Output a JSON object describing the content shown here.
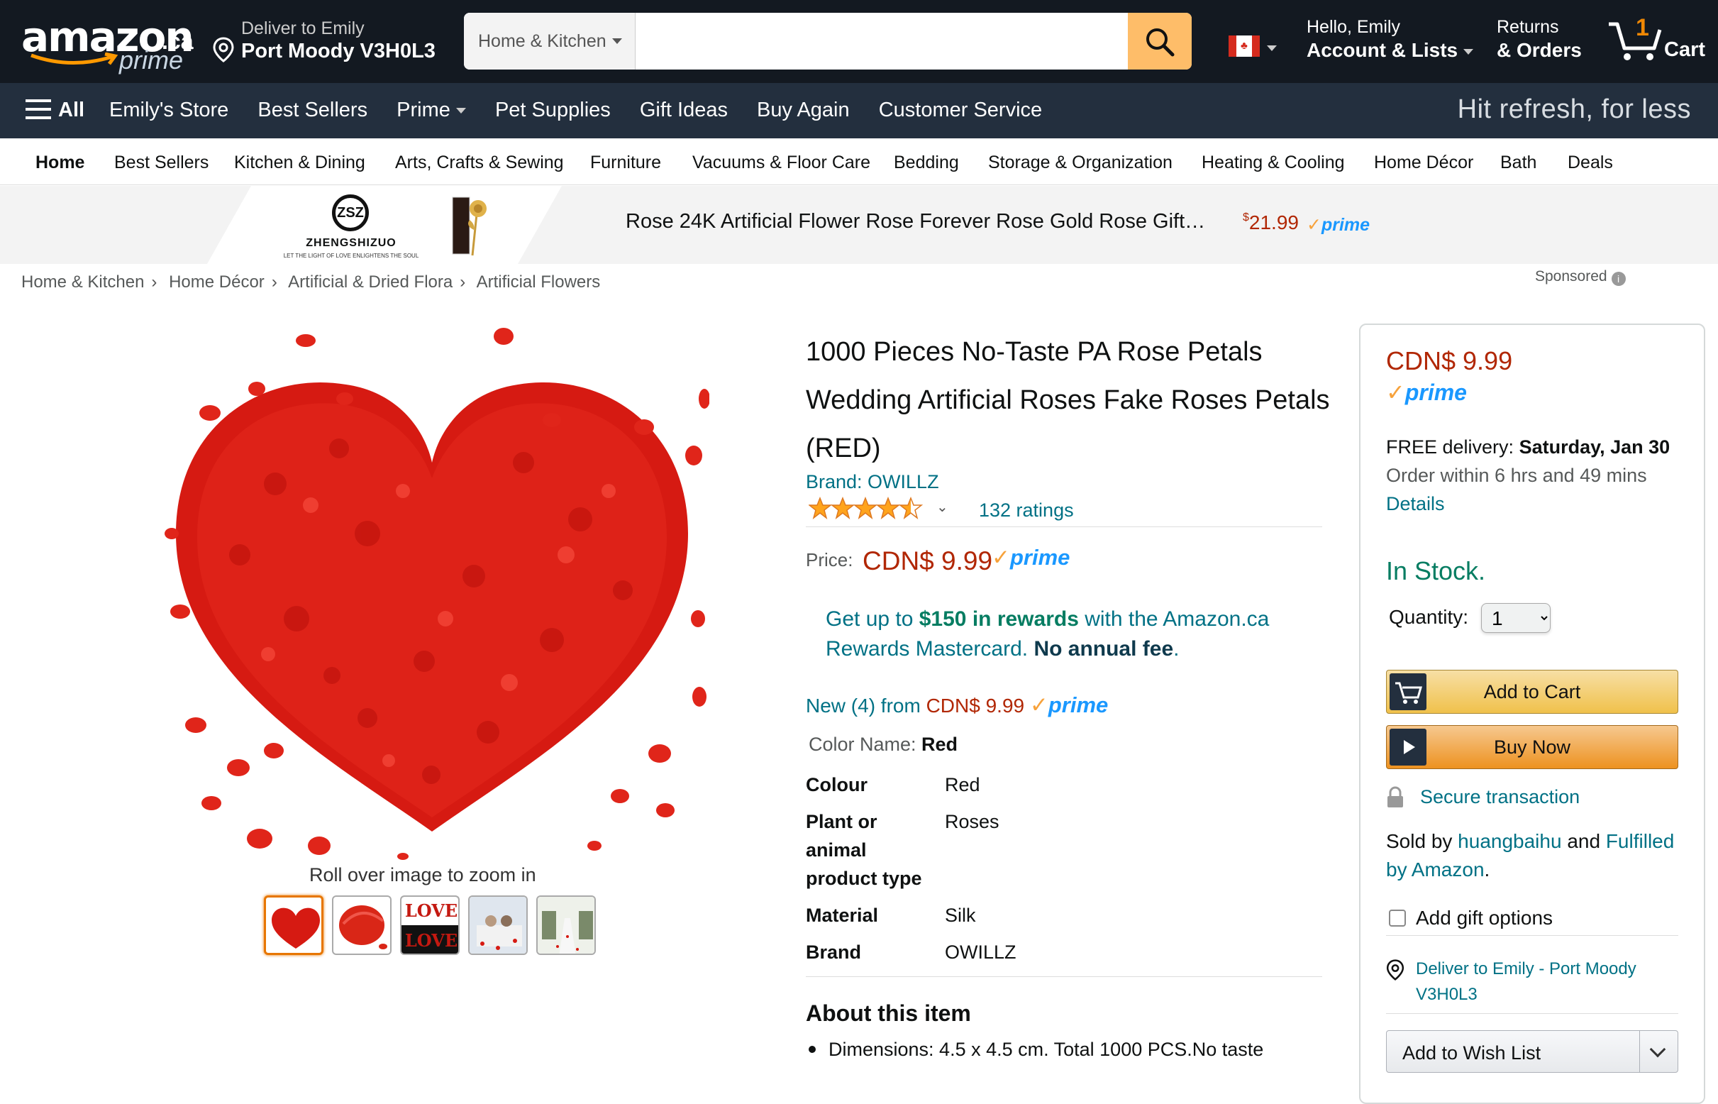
{
  "header": {
    "logo_word": "amazon",
    "logo_tld": ".ca",
    "logo_sub": "prime",
    "deliver_line1": "Deliver to Emily",
    "deliver_line2": "Port Moody V3H0L3",
    "search_category": "Home & Kitchen",
    "search_placeholder": "",
    "account_line1": "Hello, Emily",
    "account_line2": "Account & Lists",
    "returns_line1": "Returns",
    "returns_line2": "& Orders",
    "cart_count": "1",
    "cart_label": "Cart"
  },
  "main_nav": {
    "all_label": "All",
    "links": [
      "Emily's Store",
      "Best Sellers",
      "Prime",
      "Pet Supplies",
      "Gift Ideas",
      "Buy Again",
      "Customer Service"
    ],
    "promo": "Hit refresh, for less"
  },
  "sub_nav": [
    "Home",
    "Best Sellers",
    "Kitchen & Dining",
    "Arts, Crafts & Sewing",
    "Furniture",
    "Vacuums & Floor Care",
    "Bedding",
    "Storage & Organization",
    "Heating & Cooling",
    "Home Décor",
    "Bath",
    "Deals"
  ],
  "sponsored_banner": {
    "brand_mark": "ZSZ",
    "brand_name": "ZHENGSHIZUO",
    "brand_tagline": "LET THE LIGHT OF LOVE ENLIGHTENS THE SOUL",
    "title": "Rose 24K Artificial Flower Rose Forever Rose Gold Rose Gift…",
    "price_symbol": "$",
    "price": "21.99",
    "prime": "prime"
  },
  "breadcrumb": [
    "Home & Kitchen",
    "Home Décor",
    "Artificial & Dried Flora",
    "Artificial Flowers"
  ],
  "breadcrumb_sep": "›",
  "sponsored_label": "Sponsored",
  "gallery": {
    "zoom_hint": "Roll over image to zoom in",
    "thumb_love_top": "LOVE",
    "thumb_love_bottom": "LOVE"
  },
  "product": {
    "title": "1000 Pieces No-Taste PA Rose Petals Wedding Artificial Roses Fake Roses Petals (RED)",
    "brand_link": "Brand: OWILLZ",
    "rating": 4.5,
    "ratings_count": "132 ratings",
    "price_label": "Price:",
    "price": "CDN$ 9.99",
    "prime": "prime",
    "rewards_pre": "Get up to ",
    "rewards_amount": "$150 in rewards",
    "rewards_mid": " with the Amazon.ca Rewards Mastercard. ",
    "rewards_fee": "No annual fee",
    "rewards_end": ".",
    "new_from_prefix": "New (4) from ",
    "new_from_price": "CDN$ 9.99",
    "color_name_label": "Color Name: ",
    "color_name_value": "Red",
    "specs": [
      {
        "key": "Colour",
        "value": "Red"
      },
      {
        "key": "Plant or animal product type",
        "value": "Roses"
      },
      {
        "key": "Material",
        "value": "Silk"
      },
      {
        "key": "Brand",
        "value": "OWILLZ"
      }
    ],
    "about_heading": "About this item",
    "bullet_1": "Dimensions: 4.5 x 4.5 cm. Total 1000 PCS.No taste"
  },
  "buybox": {
    "price": "CDN$ 9.99",
    "prime": "prime",
    "free_delivery_label": "FREE delivery: ",
    "delivery_date": "Saturday, Jan 30",
    "order_within": "Order within 6 hrs and 49 mins",
    "details_link": "Details",
    "stock": "In Stock.",
    "quantity_label": "Quantity:",
    "quantity_value": "1",
    "add_to_cart": "Add to Cart",
    "buy_now": "Buy Now",
    "secure": "Secure transaction",
    "sold_by_prefix": "Sold by ",
    "seller": "huangbaihu",
    "sold_by_mid": " and ",
    "fulfilled": "Fulfilled by Amazon",
    "sold_by_end": ".",
    "gift_options": "Add gift options",
    "deliver_to": "Deliver to Emily - Port Moody V3H0L3",
    "wish_list": "Add to Wish List"
  },
  "colors": {
    "nav_dark": "#131921",
    "nav_secondary": "#232f3e",
    "price_red": "#b12704",
    "link_teal": "#007185",
    "in_stock_green": "#067d62",
    "prime_blue": "#1a98ff",
    "star_orange": "#ffa41c",
    "search_button": "#febd69",
    "rose_red": "#d61a12"
  },
  "icons": {
    "search": "magnifier-icon",
    "location": "location-pin-icon",
    "cart": "cart-icon",
    "flag": "canada-flag-icon",
    "lock": "lock-icon",
    "info": "info-icon"
  }
}
